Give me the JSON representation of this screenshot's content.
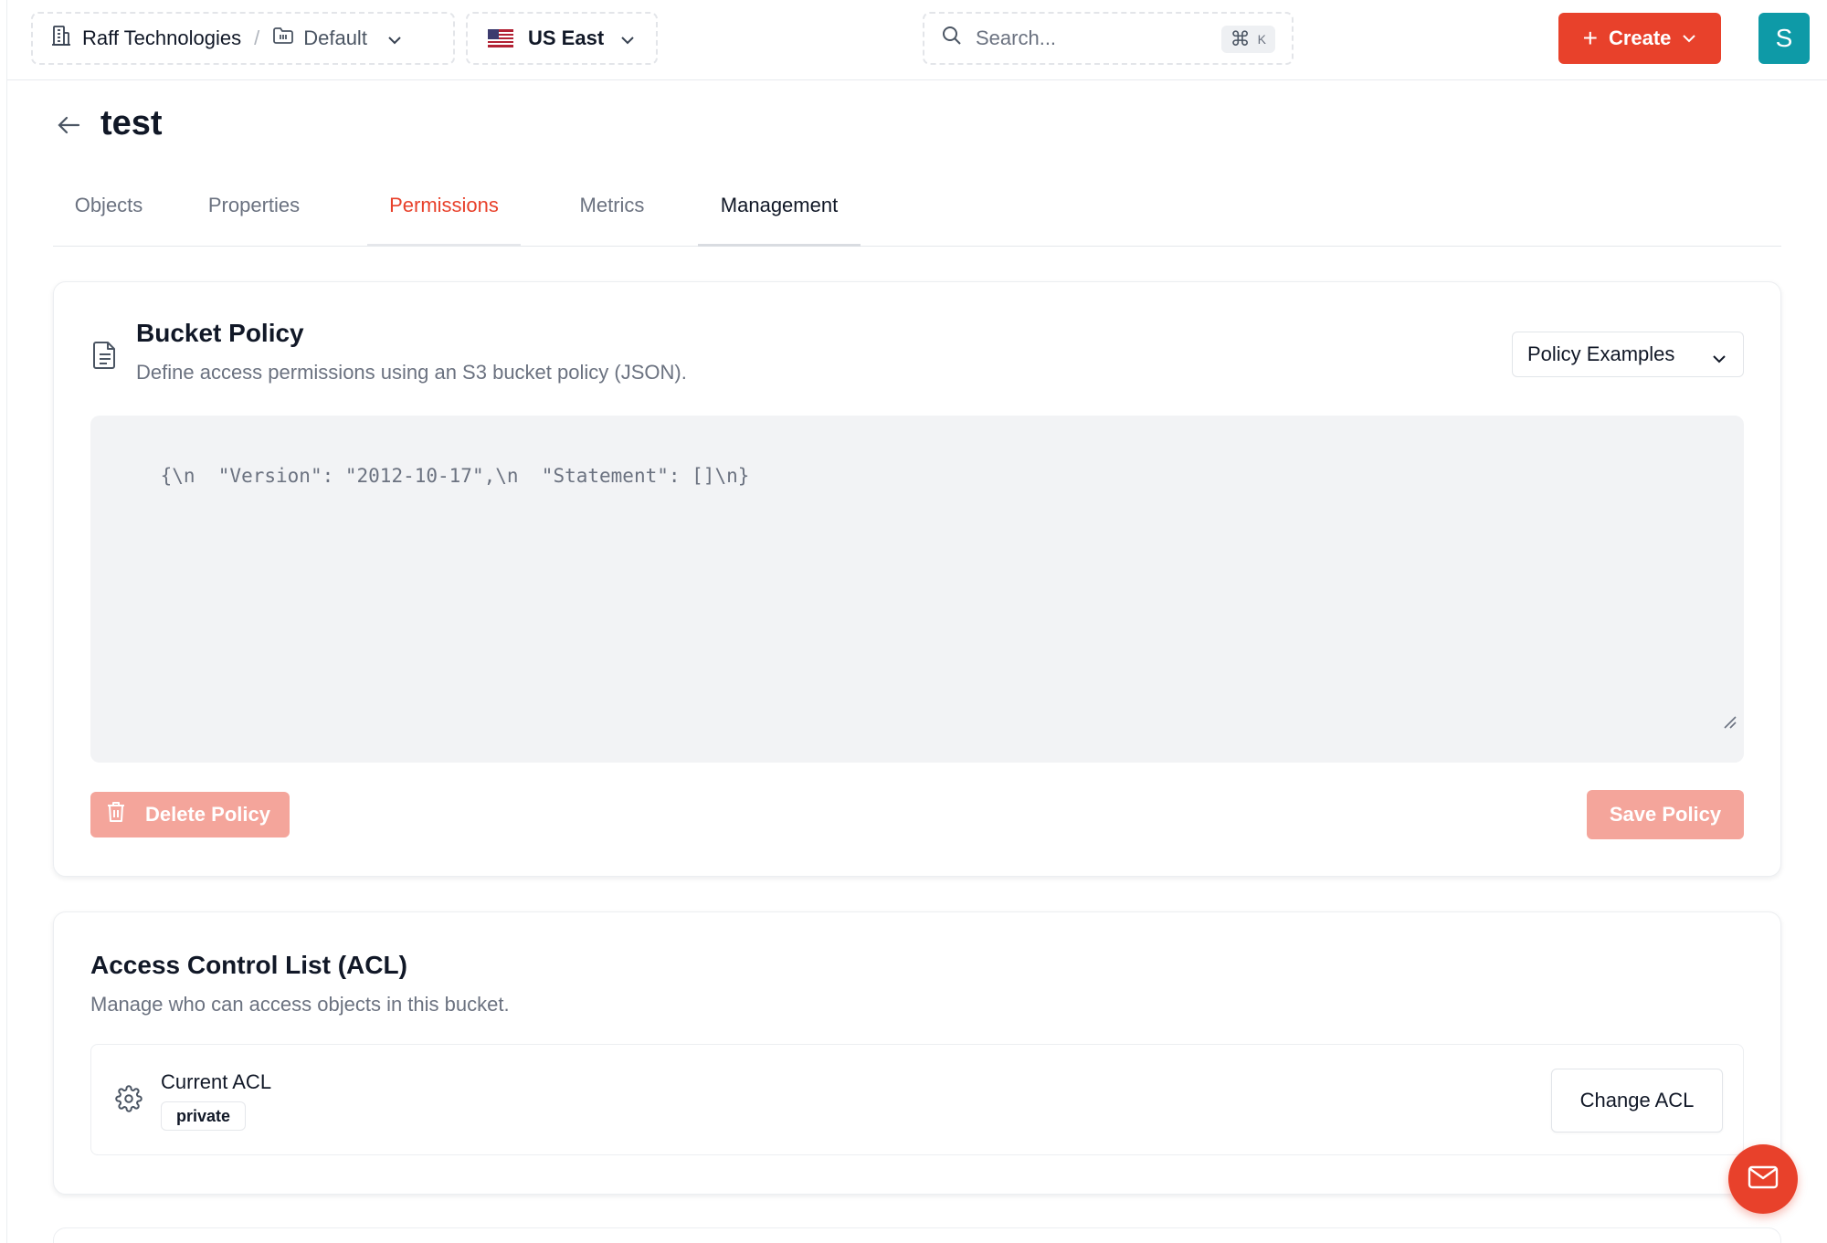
{
  "topbar": {
    "organization": "Raff Technologies",
    "separator": "/",
    "project": "Default",
    "region": "US East",
    "search_placeholder": "Search...",
    "search_shortcut_symbol": "⌘",
    "search_shortcut_key": "K",
    "create_label": "Create",
    "avatar_initial": "S"
  },
  "page": {
    "title": "test"
  },
  "tabs": [
    {
      "label": "Objects"
    },
    {
      "label": "Properties"
    },
    {
      "label": "Permissions"
    },
    {
      "label": "Metrics"
    },
    {
      "label": "Management"
    }
  ],
  "bucket_policy": {
    "title": "Bucket Policy",
    "description": "Define access permissions using an S3 bucket policy (JSON).",
    "examples_label": "Policy Examples",
    "editor_value": "{\\n  \"Version\": \"2012-10-17\",\\n  \"Statement\": []\\n}",
    "delete_label": "Delete Policy",
    "save_label": "Save Policy"
  },
  "acl": {
    "title": "Access Control List (ACL)",
    "description": "Manage who can access objects in this bucket.",
    "current_label": "Current ACL",
    "current_value": "private",
    "change_label": "Change ACL"
  },
  "colors": {
    "accent": "#e8412b",
    "accent_disabled": "#f4a59b",
    "avatar": "#0e9aa7",
    "editor_bg": "#f2f3f5"
  },
  "icons": {
    "org": "building-icon",
    "project": "folder-icon",
    "region_flag": "us-flag-icon",
    "search": "search-icon",
    "back": "arrow-left-icon",
    "policy": "document-icon",
    "delete": "trash-icon",
    "acl": "gear-icon",
    "support": "mail-icon"
  }
}
